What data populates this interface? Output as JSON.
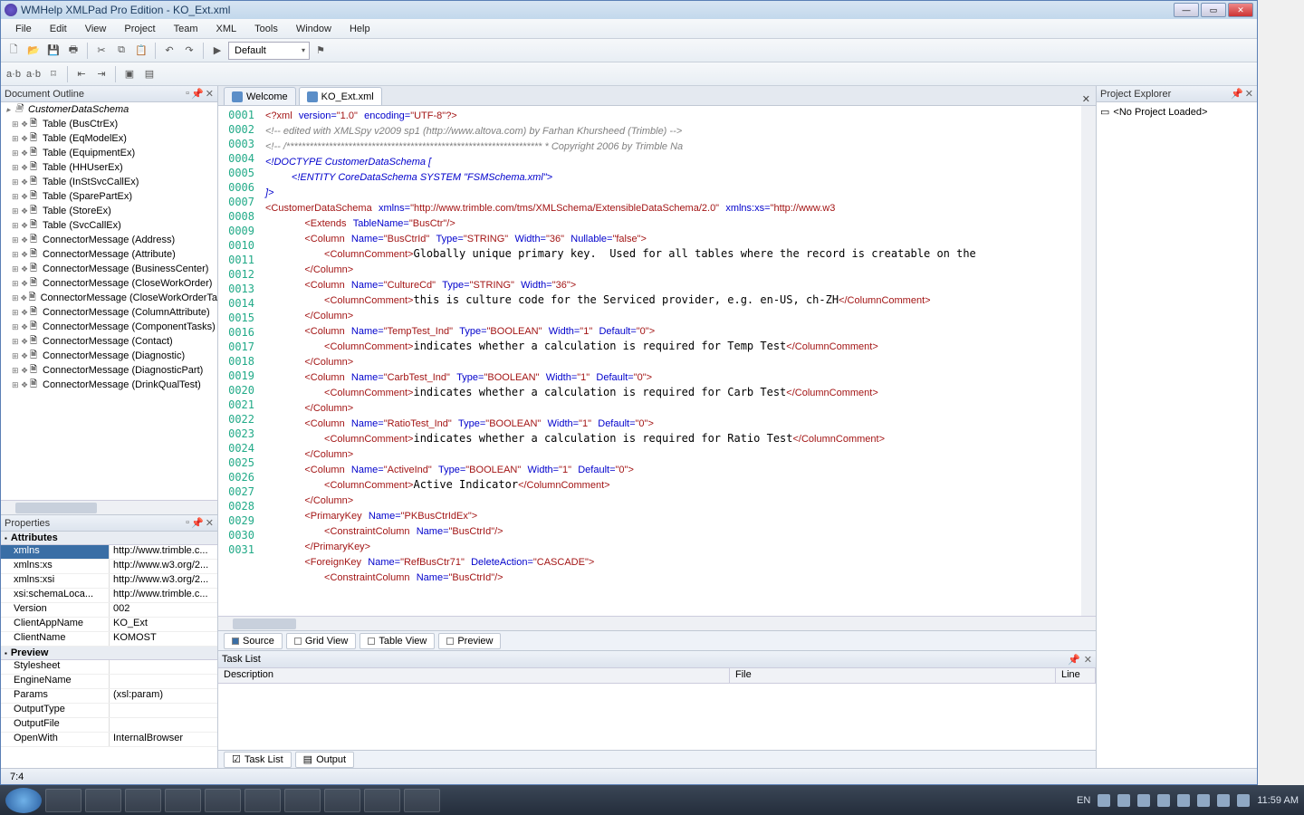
{
  "window": {
    "title": "WMHelp XMLPad Pro Edition - KO_Ext.xml"
  },
  "menu": [
    "File",
    "Edit",
    "View",
    "Project",
    "Team",
    "XML",
    "Tools",
    "Window",
    "Help"
  ],
  "toolbar": {
    "combo": "Default"
  },
  "outline": {
    "title": "Document Outline",
    "root": "CustomerDataSchema",
    "items": [
      "Table (BusCtrEx)",
      "Table (EqModelEx)",
      "Table (EquipmentEx)",
      "Table (HHUserEx)",
      "Table (InStSvcCallEx)",
      "Table (SparePartEx)",
      "Table (StoreEx)",
      "Table (SvcCallEx)",
      "ConnectorMessage (Address)",
      "ConnectorMessage (Attribute)",
      "ConnectorMessage (BusinessCenter)",
      "ConnectorMessage (CloseWorkOrder)",
      "ConnectorMessage (CloseWorkOrderTa",
      "ConnectorMessage (ColumnAttribute)",
      "ConnectorMessage (ComponentTasks)",
      "ConnectorMessage (Contact)",
      "ConnectorMessage (Diagnostic)",
      "ConnectorMessage (DiagnosticPart)",
      "ConnectorMessage (DrinkQualTest)"
    ]
  },
  "properties": {
    "title": "Properties",
    "section_attrs": "Attributes",
    "attrs": [
      {
        "k": "xmlns",
        "v": "http://www.trimble.c...",
        "sel": true
      },
      {
        "k": "xmlns:xs",
        "v": "http://www.w3.org/2..."
      },
      {
        "k": "xmlns:xsi",
        "v": "http://www.w3.org/2..."
      },
      {
        "k": "xsi:schemaLoca...",
        "v": "http://www.trimble.c..."
      },
      {
        "k": "Version",
        "v": "002"
      },
      {
        "k": "ClientAppName",
        "v": "KO_Ext"
      },
      {
        "k": "ClientName",
        "v": "KOMOST"
      }
    ],
    "section_preview": "Preview",
    "preview": [
      {
        "k": "Stylesheet",
        "v": ""
      },
      {
        "k": "EngineName",
        "v": ""
      },
      {
        "k": "Params",
        "v": "(xsl:param)"
      },
      {
        "k": "OutputType",
        "v": ""
      },
      {
        "k": "OutputFile",
        "v": ""
      },
      {
        "k": "OpenWith",
        "v": "InternalBrowser"
      }
    ]
  },
  "tabs": {
    "welcome": "Welcome",
    "file": "KO_Ext.xml"
  },
  "code": {
    "lines": [
      {
        "n": "0001",
        "h": "<span class='t'>&lt;?xml</span> <span class='a'>version=</span><span class='s'>\"1.0\"</span> <span class='a'>encoding=</span><span class='s'>\"UTF-8\"</span><span class='t'>?&gt;</span>"
      },
      {
        "n": "0002",
        "h": "<span class='c'>&lt;!-- edited with XMLSpy v2009 sp1 (http://www.altova.com) by Farhan Khursheed (Trimble) --&gt;</span>"
      },
      {
        "n": "0003",
        "h": "<span class='c'>&lt;!-- /****************************************************************** * Copyright 2006 by Trimble Na</span>"
      },
      {
        "n": "0004",
        "h": "<span class='d'>&lt;!DOCTYPE CustomerDataSchema [</span>"
      },
      {
        "n": "0005",
        "h": "    <span class='d'>&lt;!ENTITY CoreDataSchema SYSTEM \"FSMSchema.xml\"&gt;</span>"
      },
      {
        "n": "0006",
        "h": "<span class='d'>]&gt;</span>"
      },
      {
        "n": "0007",
        "h": "<span class='t'>&lt;CustomerDataSchema</span> <span class='a'>xmlns=</span><span class='s'>\"http://www.trimble.com/tms/XMLSchema/ExtensibleDataSchema/2.0\"</span> <span class='a'>xmlns:xs=</span><span class='s'>\"http://www.w3</span>"
      },
      {
        "n": "0008",
        "h": "      <span class='t'>&lt;Extends</span> <span class='a'>TableName=</span><span class='s'>\"BusCtr\"</span><span class='t'>/&gt;</span>"
      },
      {
        "n": "0009",
        "h": "      <span class='t'>&lt;Column</span> <span class='a'>Name=</span><span class='s'>\"BusCtrId\"</span> <span class='a'>Type=</span><span class='s'>\"STRING\"</span> <span class='a'>Width=</span><span class='s'>\"36\"</span> <span class='a'>Nullable=</span><span class='s'>\"false\"</span><span class='t'>&gt;</span>"
      },
      {
        "n": "0010",
        "h": "         <span class='t'>&lt;ColumnComment&gt;</span>Globally unique primary key.  Used for all tables where the record is creatable on the"
      },
      {
        "n": "0011",
        "h": "      <span class='t'>&lt;/Column&gt;</span>"
      },
      {
        "n": "0012",
        "h": "      <span class='t'>&lt;Column</span> <span class='a'>Name=</span><span class='s'>\"CultureCd\"</span> <span class='a'>Type=</span><span class='s'>\"STRING\"</span> <span class='a'>Width=</span><span class='s'>\"36\"</span><span class='t'>&gt;</span>"
      },
      {
        "n": "0013",
        "h": "         <span class='t'>&lt;ColumnComment&gt;</span>this is culture code for the Serviced provider, e.g. en-US, ch-ZH<span class='t'>&lt;/ColumnComment&gt;</span>"
      },
      {
        "n": "0014",
        "h": "      <span class='t'>&lt;/Column&gt;</span>"
      },
      {
        "n": "0015",
        "h": "      <span class='t'>&lt;Column</span> <span class='a'>Name=</span><span class='s'>\"TempTest_Ind\"</span> <span class='a'>Type=</span><span class='s'>\"BOOLEAN\"</span> <span class='a'>Width=</span><span class='s'>\"1\"</span> <span class='a'>Default=</span><span class='s'>\"0\"</span><span class='t'>&gt;</span>"
      },
      {
        "n": "0016",
        "h": "         <span class='t'>&lt;ColumnComment&gt;</span>indicates whether a calculation is required for Temp Test<span class='t'>&lt;/ColumnComment&gt;</span>"
      },
      {
        "n": "0017",
        "h": "      <span class='t'>&lt;/Column&gt;</span>"
      },
      {
        "n": "0018",
        "h": "      <span class='t'>&lt;Column</span> <span class='a'>Name=</span><span class='s'>\"CarbTest_Ind\"</span> <span class='a'>Type=</span><span class='s'>\"BOOLEAN\"</span> <span class='a'>Width=</span><span class='s'>\"1\"</span> <span class='a'>Default=</span><span class='s'>\"0\"</span><span class='t'>&gt;</span>"
      },
      {
        "n": "0019",
        "h": "         <span class='t'>&lt;ColumnComment&gt;</span>indicates whether a calculation is required for Carb Test<span class='t'>&lt;/ColumnComment&gt;</span>"
      },
      {
        "n": "0020",
        "h": "      <span class='t'>&lt;/Column&gt;</span>"
      },
      {
        "n": "0021",
        "h": "      <span class='t'>&lt;Column</span> <span class='a'>Name=</span><span class='s'>\"RatioTest_Ind\"</span> <span class='a'>Type=</span><span class='s'>\"BOOLEAN\"</span> <span class='a'>Width=</span><span class='s'>\"1\"</span> <span class='a'>Default=</span><span class='s'>\"0\"</span><span class='t'>&gt;</span>"
      },
      {
        "n": "0022",
        "h": "         <span class='t'>&lt;ColumnComment&gt;</span>indicates whether a calculation is required for Ratio Test<span class='t'>&lt;/ColumnComment&gt;</span>"
      },
      {
        "n": "0023",
        "h": "      <span class='t'>&lt;/Column&gt;</span>"
      },
      {
        "n": "0024",
        "h": "      <span class='t'>&lt;Column</span> <span class='a'>Name=</span><span class='s'>\"ActiveInd\"</span> <span class='a'>Type=</span><span class='s'>\"BOOLEAN\"</span> <span class='a'>Width=</span><span class='s'>\"1\"</span> <span class='a'>Default=</span><span class='s'>\"0\"</span><span class='t'>&gt;</span>"
      },
      {
        "n": "0025",
        "h": "         <span class='t'>&lt;ColumnComment&gt;</span>Active Indicator<span class='t'>&lt;/ColumnComment&gt;</span>"
      },
      {
        "n": "0026",
        "h": "      <span class='t'>&lt;/Column&gt;</span>"
      },
      {
        "n": "0027",
        "h": "      <span class='t'>&lt;PrimaryKey</span> <span class='a'>Name=</span><span class='s'>\"PKBusCtrIdEx\"</span><span class='t'>&gt;</span>"
      },
      {
        "n": "0028",
        "h": "         <span class='t'>&lt;ConstraintColumn</span> <span class='a'>Name=</span><span class='s'>\"BusCtrId\"</span><span class='t'>/&gt;</span>"
      },
      {
        "n": "0029",
        "h": "      <span class='t'>&lt;/PrimaryKey&gt;</span>"
      },
      {
        "n": "0030",
        "h": "      <span class='t'>&lt;ForeignKey</span> <span class='a'>Name=</span><span class='s'>\"RefBusCtr71\"</span> <span class='a'>DeleteAction=</span><span class='s'>\"CASCADE\"</span><span class='t'>&gt;</span>"
      },
      {
        "n": "0031",
        "h": "         <span class='t'>&lt;ConstraintColumn</span> <span class='a'>Name=</span><span class='s'>\"BusCtrId\"</span><span class='t'>/&gt;</span>"
      }
    ]
  },
  "bottom_tabs": {
    "source": "Source",
    "grid": "Grid View",
    "table": "Table View",
    "preview": "Preview"
  },
  "tasklist": {
    "title": "Task List",
    "cols": {
      "desc": "Description",
      "file": "File",
      "line": "Line"
    },
    "tabs": {
      "task": "Task List",
      "output": "Output"
    }
  },
  "project": {
    "title": "Project Explorer",
    "empty": "<No Project Loaded>"
  },
  "status": {
    "pos": "7:4"
  },
  "taskbar": {
    "lang": "EN",
    "time": "11:59 AM"
  }
}
